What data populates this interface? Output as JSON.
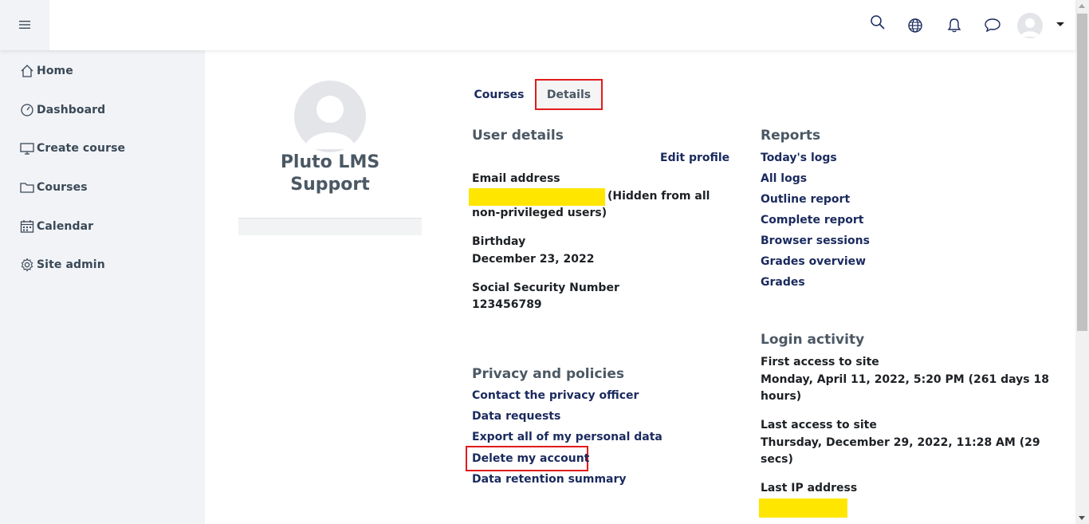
{
  "navbar": {
    "icons": [
      "menu-icon",
      "search-icon",
      "globe-icon",
      "bell-icon",
      "chat-icon",
      "avatar",
      "caret-down-icon"
    ]
  },
  "sidebar": {
    "items": [
      {
        "label": "Home",
        "icon": "home-icon"
      },
      {
        "label": "Dashboard",
        "icon": "dashboard-icon"
      },
      {
        "label": "Create course",
        "icon": "monitor-icon"
      },
      {
        "label": "Courses",
        "icon": "folder-icon"
      },
      {
        "label": "Calendar",
        "icon": "calendar-icon"
      },
      {
        "label": "Site admin",
        "icon": "gear-icon"
      }
    ]
  },
  "profile": {
    "name": "Pluto LMS Support"
  },
  "tabs": [
    {
      "label": "Courses"
    },
    {
      "label": "Details",
      "active": true
    }
  ],
  "user_details": {
    "heading": "User details",
    "edit_profile": "Edit profile",
    "email_label": "Email address",
    "email_note_1": "(Hidden from all",
    "email_note_2": "non-privileged users)",
    "birthday_label": "Birthday",
    "birthday_value": "December 23, 2022",
    "ssn_label": "Social Security Number",
    "ssn_value": "123456789"
  },
  "privacy": {
    "heading": "Privacy and policies",
    "links": [
      "Contact the privacy officer",
      "Data requests",
      "Export all of my personal data",
      "Delete my account",
      "Data retention summary"
    ]
  },
  "reports": {
    "heading": "Reports",
    "links": [
      "Today's logs",
      "All logs",
      "Outline report",
      "Complete report",
      "Browser sessions",
      "Grades overview",
      "Grades"
    ]
  },
  "login_activity": {
    "heading": "Login activity",
    "first_access_label": "First access to site",
    "first_access_value_1": "Monday, April 11, 2022, 5:20 PM  (261 days 18",
    "first_access_value_2": "hours)",
    "last_access_label": "Last access to site",
    "last_access_value_1": "Thursday, December 29, 2022, 11:28 AM  (29",
    "last_access_value_2": "secs)",
    "last_ip_label": "Last IP address"
  },
  "colors": {
    "link": "#1a2a5e",
    "highlight": "#ffe600",
    "annotation_box": "#e21b1b",
    "sidebar_bg": "#f1f3f7"
  }
}
